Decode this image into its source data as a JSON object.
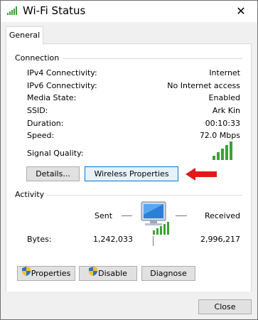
{
  "window": {
    "title": "Wi-Fi Status",
    "close_glyph": "✕",
    "title_icon": "wifi-signal-icon"
  },
  "tabs": [
    {
      "label": "General",
      "selected": true
    }
  ],
  "connection": {
    "group_label": "Connection",
    "rows": [
      {
        "label": "IPv4 Connectivity:",
        "value": "Internet"
      },
      {
        "label": "IPv6 Connectivity:",
        "value": "No Internet access"
      },
      {
        "label": "Media State:",
        "value": "Enabled"
      },
      {
        "label": "SSID:",
        "value": "Ark Kin"
      },
      {
        "label": "Duration:",
        "value": "00:10:33"
      },
      {
        "label": "Speed:",
        "value": "72.0 Mbps"
      }
    ],
    "signal_label": "Signal Quality:",
    "signal_bars": 5,
    "details_button": "Details...",
    "wireless_button": "Wireless Properties"
  },
  "activity": {
    "group_label": "Activity",
    "sent_label": "Sent",
    "received_label": "Received",
    "bytes_label": "Bytes:",
    "bytes_sent": "1,242,033",
    "bytes_received": "2,996,217"
  },
  "actions": {
    "properties": "Properties",
    "disable": "Disable",
    "diagnose": "Diagnose"
  },
  "footer": {
    "close": "Close"
  },
  "colors": {
    "accent": "#0078d7",
    "signal_green": "#3aa335",
    "arrow_red": "#e11919"
  }
}
